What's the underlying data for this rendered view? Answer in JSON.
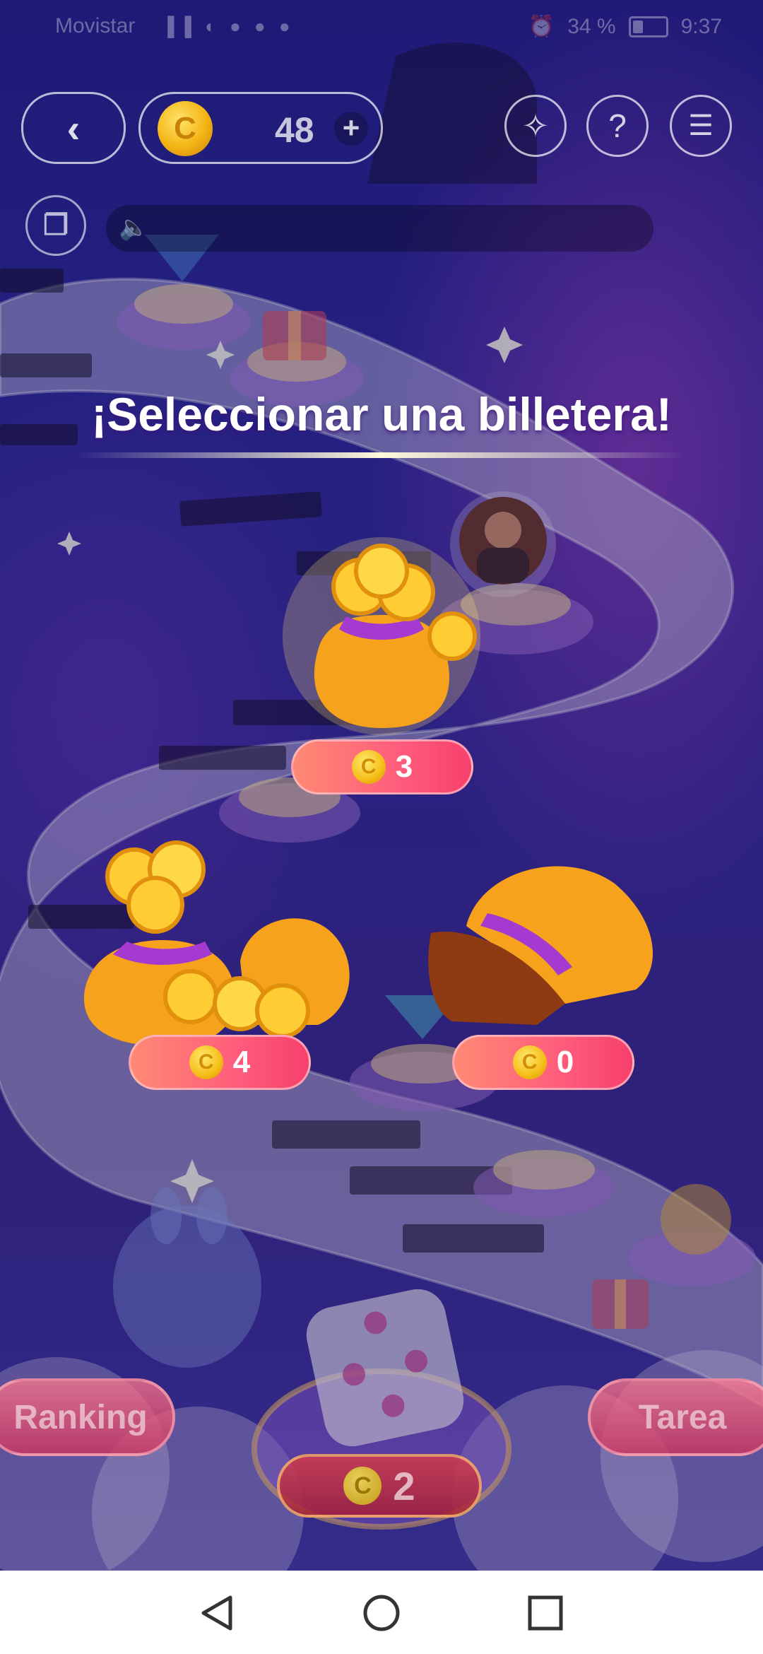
{
  "status_bar": {
    "carrier": "Movistar",
    "system_icons": "▐▐ ◐ ● ● ●",
    "battery_text": "34 %",
    "battery_level": 0.34,
    "time": "9:37"
  },
  "top_bar": {
    "back_icon": "chevron-left-icon",
    "coins": "48",
    "coin_glyph": "C",
    "plus_label": "+",
    "magic_icon": "magic-wand-icon",
    "help_label": "?",
    "settings_icon": "menu-settings-icon",
    "share_glyph": "❐",
    "speaker_glyph": "🔈"
  },
  "dialog": {
    "title": "¡Seleccionar una billetera!",
    "wallets": [
      {
        "value": "3",
        "coin_glyph": "C"
      },
      {
        "value": "4",
        "coin_glyph": "C"
      },
      {
        "value": "0",
        "coin_glyph": "C"
      }
    ]
  },
  "game": {
    "ranking_label": "Ranking",
    "task_label": "Tarea",
    "dice_count": "2",
    "coin_glyph": "C"
  },
  "nav": {
    "back": "back-triangle-icon",
    "home": "home-circle-icon",
    "recents": "recents-square-icon"
  }
}
